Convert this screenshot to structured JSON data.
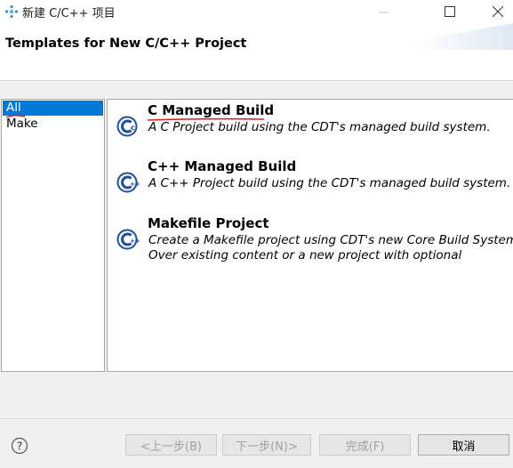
{
  "window": {
    "title": "新建 C/C++ 项目",
    "minimize_glyph": "—",
    "maximize_glyph": "☐",
    "close_glyph": "✕"
  },
  "header": {
    "title": "Templates for New C/C++ Project"
  },
  "filters": {
    "items": [
      {
        "label": "All",
        "selected": true
      },
      {
        "label": "Make",
        "selected": false
      }
    ]
  },
  "templates": {
    "items": [
      {
        "name": "C Managed Build",
        "description": "A C Project build using the CDT's managed build system.",
        "icon": "cdt-c-icon"
      },
      {
        "name": "C++ Managed Build",
        "description": "A C++ Project build using the CDT's managed build system.",
        "icon": "cdt-cpp-icon"
      },
      {
        "name": "Makefile Project",
        "description": "Create a Makefile project using CDT's new Core Build System. Over existing content or a new project with optional",
        "icon": "cdt-makefile-icon"
      }
    ]
  },
  "footer": {
    "back_label": "<上一步(B)",
    "next_label": "下一步(N)>",
    "finish_label": "完成(F)",
    "cancel_label": "取消",
    "help_icon": "question-icon"
  },
  "colors": {
    "selection": "#0078d7",
    "icon_blue": "#1f4e9c",
    "annotation_red": "#d21e1e"
  }
}
